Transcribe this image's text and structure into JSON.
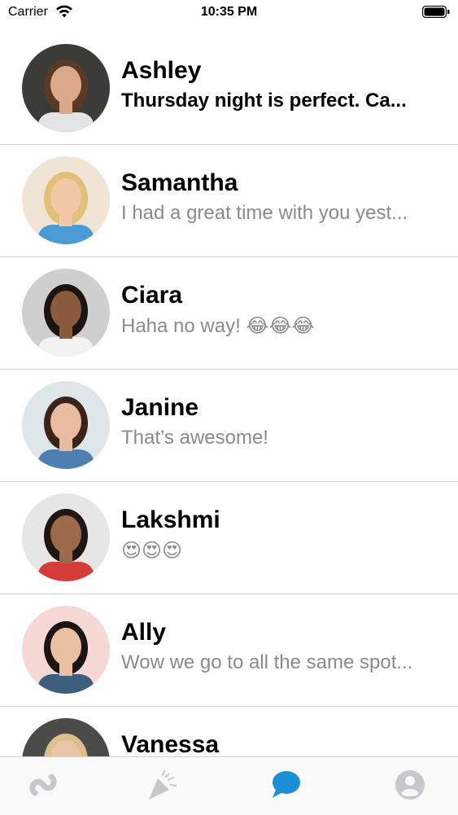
{
  "status_bar": {
    "carrier": "Carrier",
    "time": "10:35 PM"
  },
  "messages": [
    {
      "name": "Ashley",
      "preview": "Thursday night is perfect. Ca...",
      "unread": true,
      "avatar_bg": "#3b3b38",
      "skin": "#d9a98a",
      "hair": "#5a3a24",
      "shirt": "#e4e4e4"
    },
    {
      "name": "Samantha",
      "preview": "I had a great time with you yest...",
      "unread": false,
      "avatar_bg": "#f0e4d4",
      "skin": "#f1c7a6",
      "hair": "#e2c07a",
      "shirt": "#4a9ad4"
    },
    {
      "name": "Ciara",
      "preview": "Haha no way! 😂😂😂",
      "unread": false,
      "avatar_bg": "#cfcfcf",
      "skin": "#8a5a3c",
      "hair": "#1b1410",
      "shirt": "#f2f2f2"
    },
    {
      "name": "Janine",
      "preview": "That’s awesome!",
      "unread": false,
      "avatar_bg": "#dfe6ea",
      "skin": "#e7bca0",
      "hair": "#3a2418",
      "shirt": "#4e7fae"
    },
    {
      "name": "Lakshmi",
      "preview": "😍😍😍",
      "unread": false,
      "avatar_bg": "#e6e6e6",
      "skin": "#9c6a4a",
      "hair": "#1e1612",
      "shirt": "#d63a3a"
    },
    {
      "name": "Ally",
      "preview": "Wow we go to all the same spot...",
      "unread": false,
      "avatar_bg": "#f6d9d4",
      "skin": "#eac0a2",
      "hair": "#1a1412",
      "shirt": "#3d5f7d"
    },
    {
      "name": "Vanessa",
      "preview": "",
      "unread": false,
      "avatar_bg": "#4b4b48",
      "skin": "#e9c3a5",
      "hair": "#d9c08c",
      "shirt": "#333333"
    }
  ],
  "tab_bar": {
    "tabs": [
      {
        "icon": "discover-icon",
        "active": false
      },
      {
        "icon": "celebrate-icon",
        "active": false
      },
      {
        "icon": "chat-icon",
        "active": true
      },
      {
        "icon": "profile-icon",
        "active": false
      }
    ],
    "active_color": "#1a8fd6",
    "inactive_color": "#c8c8cc"
  }
}
